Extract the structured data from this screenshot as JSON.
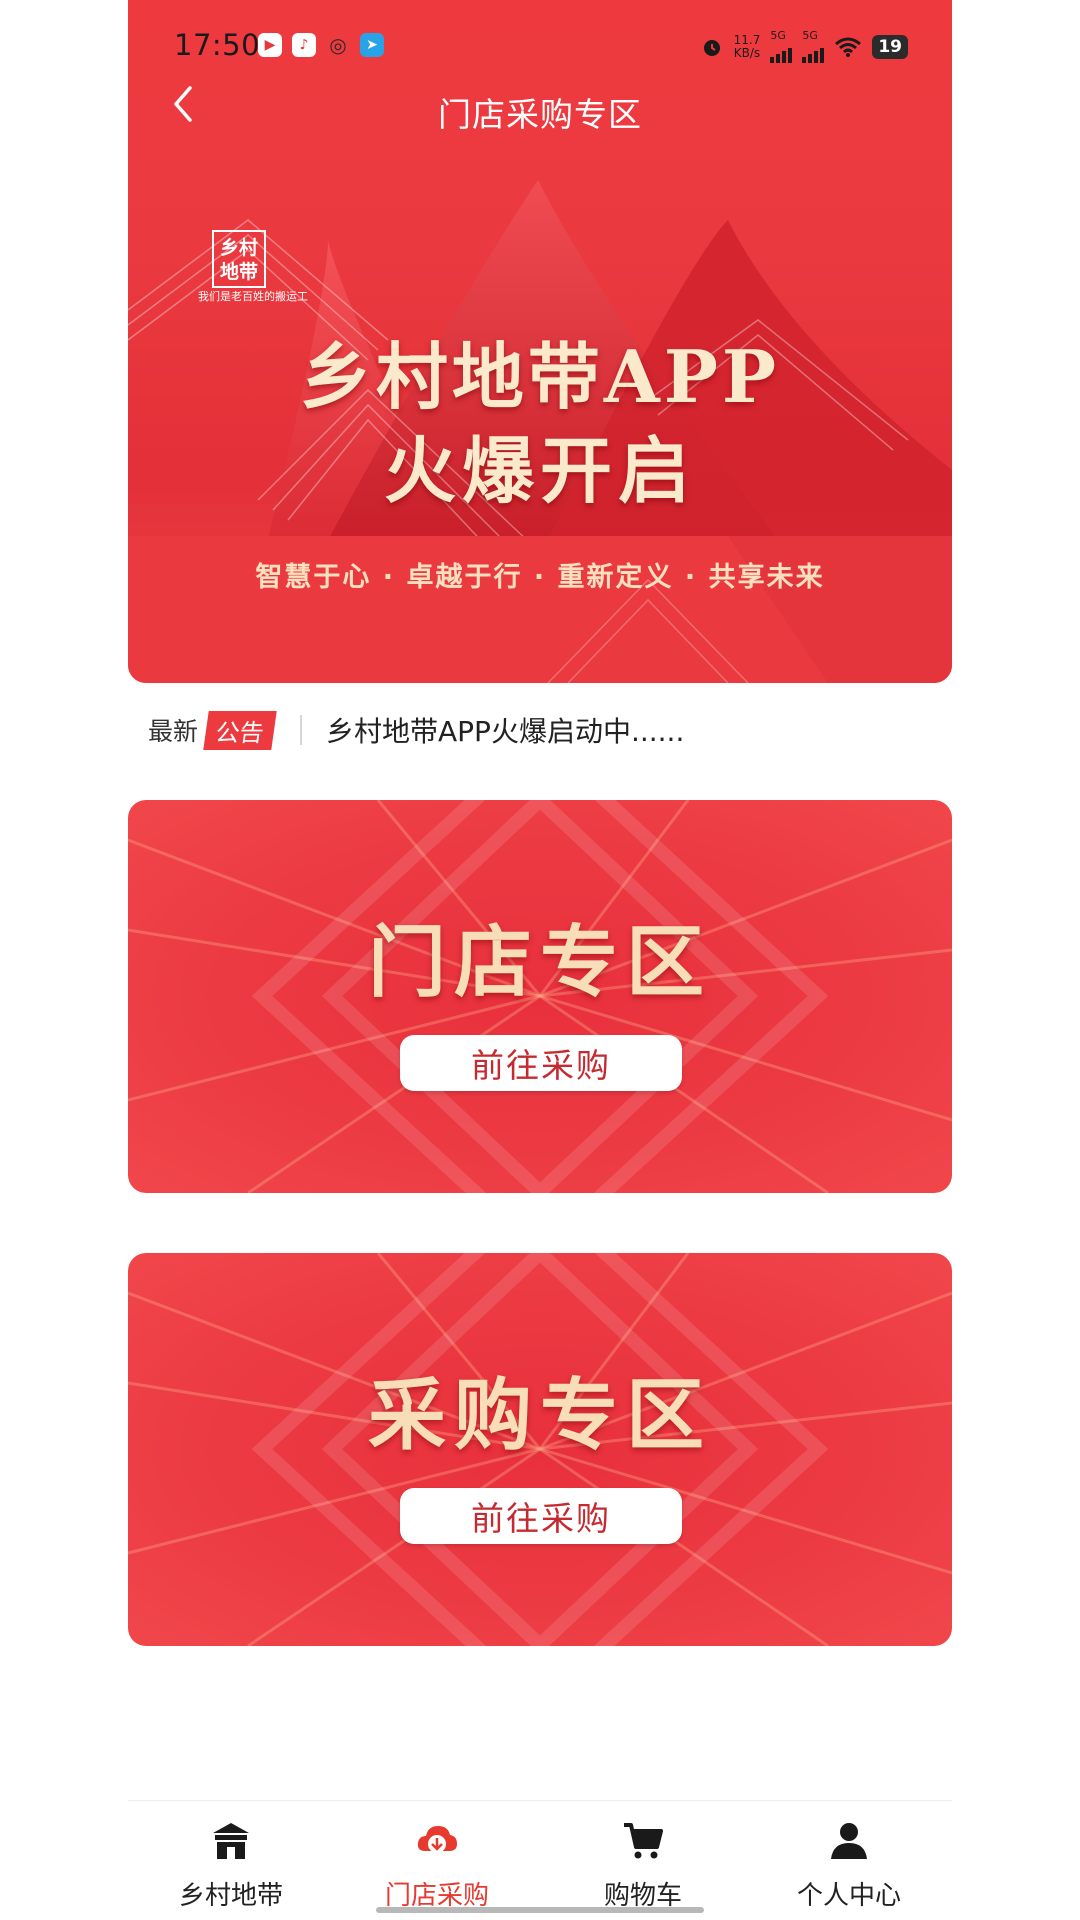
{
  "status_bar": {
    "time": "17:50",
    "net_speed_value": "11.7",
    "net_speed_unit": "KB/s",
    "sim1": "5G",
    "sim2": "5G",
    "battery": "19",
    "icons": [
      "video-app-icon",
      "music-app-icon",
      "wechat-icon",
      "telegram-icon",
      "alarm-icon",
      "wifi-icon"
    ]
  },
  "header": {
    "title": "门店采购专区"
  },
  "banner": {
    "logo_text": "乡村地带",
    "logo_tagline": "我们是老百姓的搬运工",
    "headline_line1": "乡村地带APP",
    "headline_line2": "火爆开启",
    "tagline": "智慧于心 · 卓越于行 · 重新定义 · 共享未来"
  },
  "notice": {
    "latest_label": "最新",
    "tag": "公告",
    "text": "乡村地带APP火爆启动中......"
  },
  "cards": [
    {
      "title": "门店专区",
      "button": "前往采购"
    },
    {
      "title": "采购专区",
      "button": "前往采购"
    }
  ],
  "tabbar": {
    "items": [
      {
        "label": "乡村地带",
        "icon": "home-icon",
        "active": false
      },
      {
        "label": "门店采购",
        "icon": "store-download-icon",
        "active": true
      },
      {
        "label": "购物车",
        "icon": "cart-icon",
        "active": false
      },
      {
        "label": "个人中心",
        "icon": "user-icon",
        "active": false
      }
    ]
  },
  "colors": {
    "brand_red": "#ec3a3f",
    "active_tab": "#e8392f",
    "gold_text": "#fbe9cc"
  }
}
